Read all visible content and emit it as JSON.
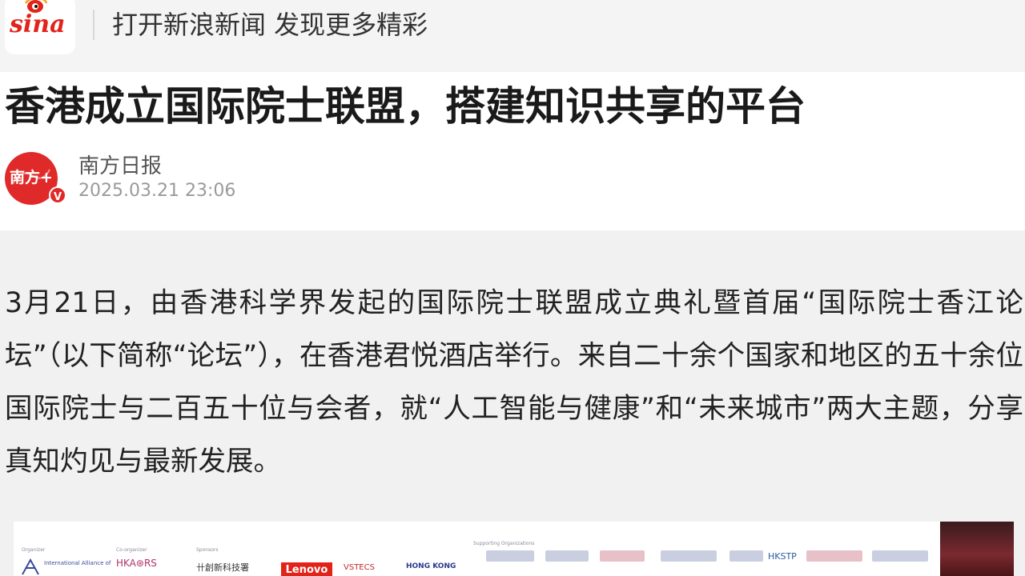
{
  "app_banner": {
    "logo_text": "sina",
    "slogan": "打开新浪新闻 发现更多精彩"
  },
  "article": {
    "title": "香港成立国际院士联盟，搭建知识共享的平台",
    "source": {
      "name": "南方日报",
      "avatar_text": "南方+",
      "verified_badge": "V",
      "published": "2025.03.21 23:06"
    },
    "paragraph": "3月21日，由香港科学界发起的国际院士联盟成立典礼暨首届“国际院士香江论坛”（以下简称“论坛”），在香港君悦酒店举行。来自二十余个国家和地区的五十余位国际院士与二百五十位与会者，就“人工智能与健康”和“未来城市”两大主题，分享真知灼见与最新发展。",
    "photo": {
      "labels": {
        "organizer": "Organizer",
        "co_organizer": "Co-organizer",
        "sponsors": "Sponsors",
        "supporting": "Supporting Organizations"
      },
      "orgs": {
        "alliance": "International Alliance of",
        "hkaors": "HKA⊛RS",
        "sponsor1": "卄創新科技署",
        "lenovo": "Lenovo",
        "vstecs": "VSTECS",
        "hongkong": "HONG KONG",
        "hkstp": "HKSTP"
      }
    }
  },
  "colors": {
    "brand_red": "#e2231a",
    "banner_bg": "#f4f4f4",
    "body_bg": "#f1f1f1",
    "avatar_red": "#e02a2a"
  }
}
